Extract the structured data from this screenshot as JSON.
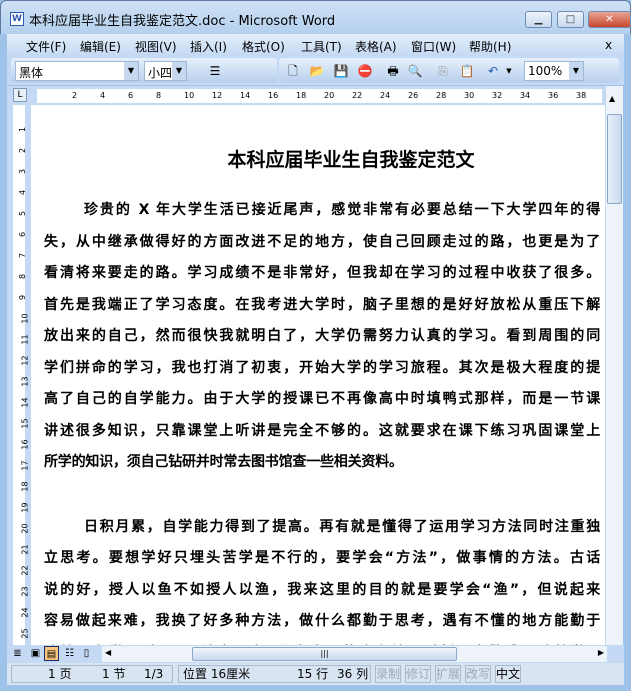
{
  "window": {
    "title": "本科应届毕业生自我鉴定范文.doc - Microsoft Word",
    "minimize": "▁",
    "maximize": "□",
    "close": "✕"
  },
  "menu": [
    "文件(F)",
    "编辑(E)",
    "视图(V)",
    "插入(I)",
    "格式(O)",
    "工具(T)",
    "表格(A)",
    "窗口(W)",
    "帮助(H)"
  ],
  "menu_close": "x",
  "toolbar": {
    "font": "黑体",
    "size": "小四",
    "zoom": "100%"
  },
  "ruler": {
    "ticks": [
      "2",
      "4",
      "6",
      "8",
      "10",
      "12",
      "14",
      "16",
      "18",
      "20",
      "22",
      "24",
      "26",
      "28",
      "30",
      "32",
      "34",
      "36",
      "38"
    ],
    "vticks": [
      "1",
      "2",
      "3",
      "4",
      "5",
      "6",
      "7",
      "8",
      "9",
      "10",
      "11",
      "12",
      "13",
      "14",
      "15",
      "16",
      "17",
      "18",
      "19",
      "20",
      "21",
      "22",
      "23",
      "24",
      "25"
    ]
  },
  "document": {
    "title": "本科应届毕业生自我鉴定范文",
    "paragraphs": [
      [
        "珍贵的 X 年大学生活已接近尾声，感觉非常有必要总结一下大学四年的得",
        "失，从中继承做得好的方面改进不足的地方，使自己回顾走过的路，也更是为了",
        "看清将来要走的路。学习成绩不是非常好，但我却在学习的过程中收获了很多。",
        "首先是我端正了学习态度。在我考进大学时，脑子里想的是好好放松从重压下解",
        "放出来的自己，然而很快我就明白了，大学仍需努力认真的学习。看到周围的同",
        "学们拼命的学习，我也打消了初衷，开始大学的学习旅程。其次是极大程度的提",
        "高了自己的自学能力。由于大学的授课已不再像高中时填鸭式那样，而是一节课",
        "讲述很多知识，只靠课堂上听讲是完全不够的。这就要求在课下练习巩固课堂上",
        "所学的知识，须自己钻研并时常去图书馆查一些相关资料。"
      ],
      [
        "日积月累，自学能力得到了提高。再有就是懂得了运用学习方法同时注重独",
        "立思考。要想学好只埋头苦学是不行的，要学会“方法”，做事情的方法。古话",
        "说的好，授人以鱼不如授人以渔，我来这里的目的就是要学会“渔”，但说起来",
        "容易做起来难，我换了好多种方法，做什么都勤于思考，遇有不懂的地方能勤于",
        "请教。在学习时，以“独立思考”作为自己的座右铭，时刻不忘警戒。随着学习"
      ]
    ]
  },
  "status": {
    "page": "1 页",
    "section": "1 节",
    "pages": "1/3",
    "position": "位置 16厘米",
    "line": "15 行",
    "column": "36 列",
    "rec": "录制",
    "trk": "修订",
    "ext": "扩展",
    "ovr": "改写",
    "lang": "中文"
  }
}
